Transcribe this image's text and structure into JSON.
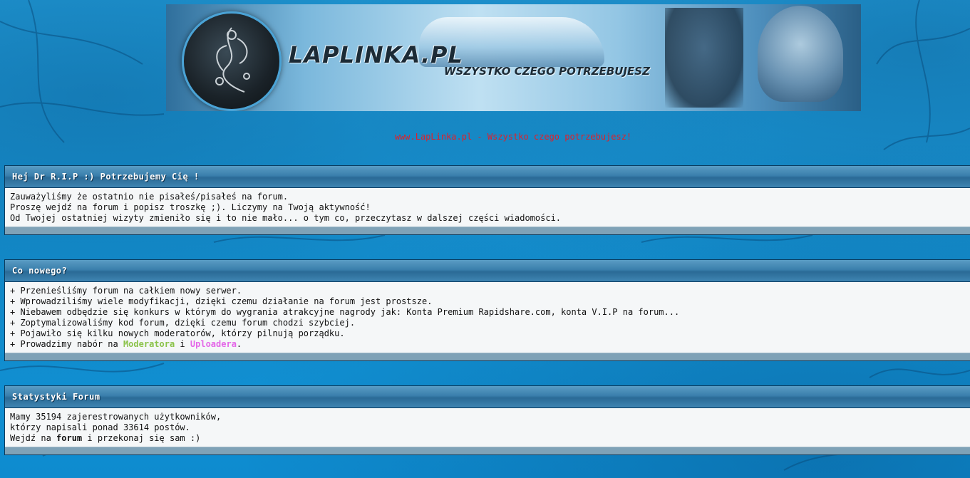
{
  "banner": {
    "logo_text": "LAPLINKA.PL",
    "slogan": "WSZYSTKO CZEGO POTRZEBUJESZ"
  },
  "tagline": "www.LapLinka.pl - Wszystko czego potrzebujesz!",
  "panels": {
    "welcome": {
      "title": "Hej Dr R.I.P :) Potrzebujemy Cię !",
      "lines": [
        "Zauważyliśmy że ostatnio nie pisałeś/pisałeś na forum.",
        "Proszę wejdź na forum i popisz troszkę ;). Liczymy na Twoją aktywność!",
        "Od Twojej ostatniej wizyty zmieniło się i to nie mało... o tym co, przeczytasz w dalszej części wiadomości."
      ]
    },
    "news": {
      "title": "Co nowego?",
      "lines": [
        "+ Przenieśliśmy forum na całkiem nowy serwer.",
        "+ Wprowadziliśmy wiele modyfikacji, dzięki czemu działanie na forum jest prostsze.",
        "+ Niebawem odbędzie się konkurs w którym do wygrania atrakcyjne nagrody jak: Konta Premium Rapidshare.com, konta V.I.P na forum...",
        "+ Zoptymalizowaliśmy kod forum, dzięki czemu forum chodzi szybciej.",
        "+ Pojawiło się kilku nowych moderatorów, którzy pilnują porządku."
      ],
      "recruit": {
        "prefix": "+ Prowadzimy nabór na ",
        "moderator": "Moderatora",
        "conj": " i ",
        "uploader": "Uploadera",
        "suffix": "."
      }
    },
    "stats": {
      "title": "Statystyki Forum",
      "line1": "Mamy 35194 zajerestrowanych użytkowników,",
      "line2": "którzy napisali ponad 33614 postów.",
      "line3_prefix": "Wejdź na ",
      "line3_link": "forum",
      "line3_suffix": " i przekonaj się sam :)"
    }
  },
  "colors": {
    "background": "#1b97d6",
    "tagline": "#e0202a",
    "panel_header": "#3a7fac",
    "moderator": "#8bc34a",
    "uploader": "#e467e8"
  }
}
